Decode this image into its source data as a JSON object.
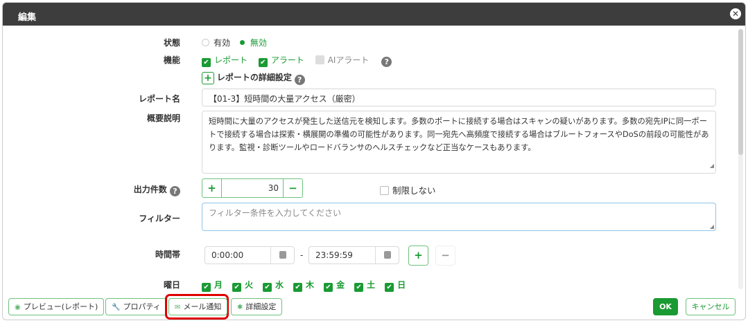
{
  "dialog": {
    "title": "編集"
  },
  "status": {
    "label": "状態",
    "options": [
      "有効",
      "無効"
    ],
    "selected": "無効"
  },
  "features": {
    "label": "機能",
    "items": [
      {
        "label": "レポート",
        "checked": true
      },
      {
        "label": "アラート",
        "checked": true
      },
      {
        "label": "AIアラート",
        "checked": false,
        "disabled": true
      }
    ],
    "detail_label": "レポートの詳細設定"
  },
  "report_name": {
    "label": "レポート名",
    "value": "【01-3】短時間の大量アクセス（厳密）"
  },
  "description": {
    "label": "概要説明",
    "value": "短時間に大量のアクセスが発生した送信元を検知します。多数のポートに接続する場合はスキャンの疑いがあります。多数の宛先IPに同一ポートで接続する場合は探索・横展開の準備の可能性があります。同一宛先へ高頻度で接続する場合はブルートフォースやDoSの前段の可能性があります。監視・診断ツールやロードバランサのヘルスチェックなど正当なケースもあります。"
  },
  "output_count": {
    "label": "出力件数",
    "value": "30",
    "plus": "+",
    "minus": "−",
    "unlimited_label": "制限しない",
    "unlimited": false
  },
  "filter": {
    "label": "フィルター",
    "placeholder": "フィルター条件を入力してください"
  },
  "time_range": {
    "label": "時間帯",
    "start": "0:00:00",
    "end": "23:59:59",
    "separator": "-",
    "add": "+",
    "remove": "−"
  },
  "weekdays": {
    "label": "曜日",
    "days": [
      "月",
      "火",
      "水",
      "木",
      "金",
      "土",
      "日"
    ]
  },
  "footer": {
    "tabs": [
      "プレビュー(レポート)",
      "プロパティ",
      "メール通知",
      "詳細設定"
    ],
    "active_tab": "メール通知",
    "ok": "OK",
    "cancel": "キャンセル"
  },
  "colors": {
    "accent": "#1a9a33",
    "header": "#3d3d3d",
    "highlight": "#e00000"
  }
}
